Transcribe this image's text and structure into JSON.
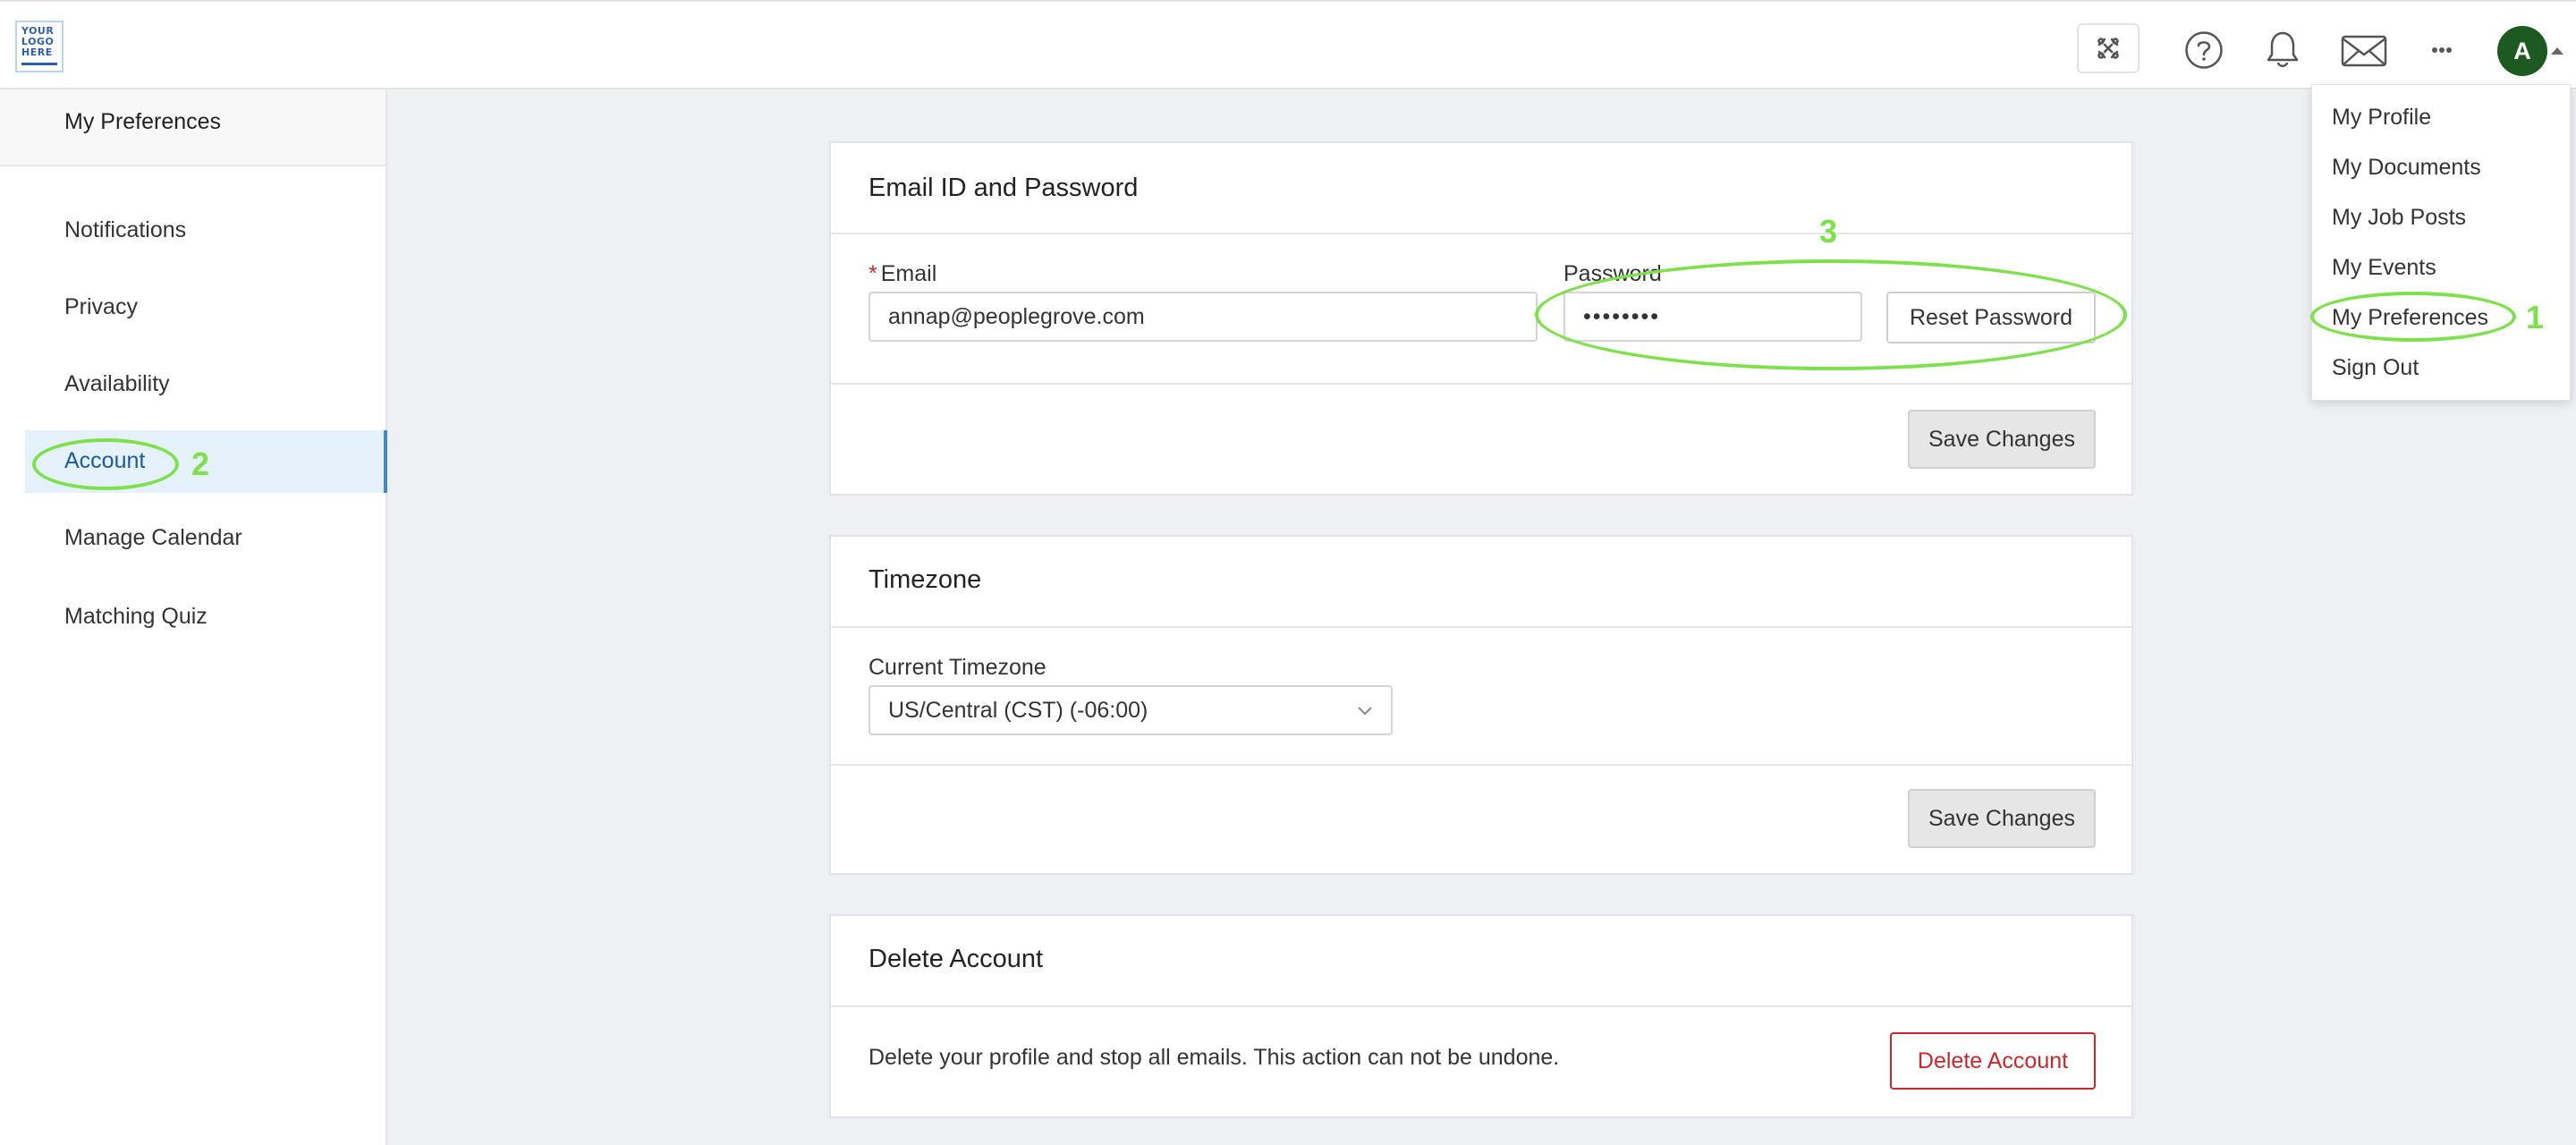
{
  "header": {
    "logo_text": "YOUR\nLOGO\nHERE",
    "avatar_initial": "A"
  },
  "icons": [
    "logo-icon",
    "apps-icon",
    "help-icon",
    "bell-icon",
    "mail-icon",
    "more-icon",
    "avatar-caret-icon",
    "chevron-down-icon"
  ],
  "sidebar": {
    "title": "My Preferences",
    "items": [
      {
        "label": "Notifications",
        "active": false
      },
      {
        "label": "Privacy",
        "active": false
      },
      {
        "label": "Availability",
        "active": false
      },
      {
        "label": "Account",
        "active": true
      },
      {
        "label": "Manage Calendar",
        "active": false
      },
      {
        "label": "Matching Quiz",
        "active": false
      }
    ]
  },
  "email_card": {
    "title": "Email ID and Password",
    "email_label": "Email",
    "email_value": "annap@peoplegrove.com",
    "password_label": "Password",
    "password_value": "••••••••",
    "reset_button": "Reset Password",
    "save_button": "Save Changes"
  },
  "timezone_card": {
    "title": "Timezone",
    "label": "Current Timezone",
    "selected": "US/Central (CST) (-06:00)",
    "save_button": "Save Changes"
  },
  "delete_card": {
    "title": "Delete Account",
    "description": "Delete your profile and stop all emails. This action can not be undone.",
    "delete_button": "Delete Account"
  },
  "user_menu": {
    "items": [
      "My Profile",
      "My Documents",
      "My Job Posts",
      "My Events",
      "My Preferences",
      "Sign Out"
    ]
  },
  "annotations": [
    "1",
    "2",
    "3"
  ],
  "colors": {
    "accent": "#4289c9",
    "active_bg": "#e5f2fb",
    "danger": "#c8282c",
    "avatar": "#1d5a21",
    "annotation": "#7ee04d"
  }
}
